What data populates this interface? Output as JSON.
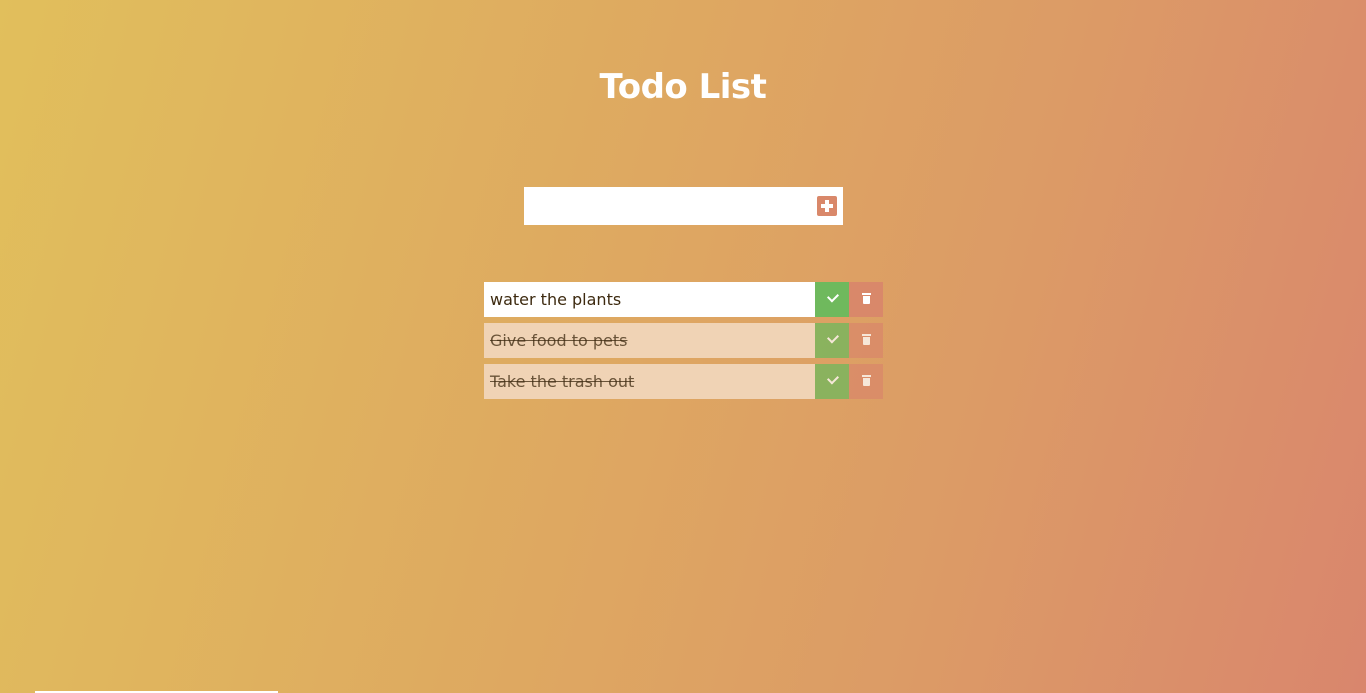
{
  "page": {
    "title": "Todo List"
  },
  "input": {
    "value": "",
    "placeholder": ""
  },
  "add_button": {
    "icon": "plus-square-icon"
  },
  "todos": [
    {
      "text": "water the plants",
      "completed": false
    },
    {
      "text": "Give food to pets",
      "completed": true
    },
    {
      "text": "Take the trash out",
      "completed": true
    }
  ],
  "colors": {
    "accent": "#d9886a",
    "check": "#6fb95d",
    "text": "#3d2a10",
    "background_start": "#e1bf5c",
    "background_end": "#d9866d"
  }
}
